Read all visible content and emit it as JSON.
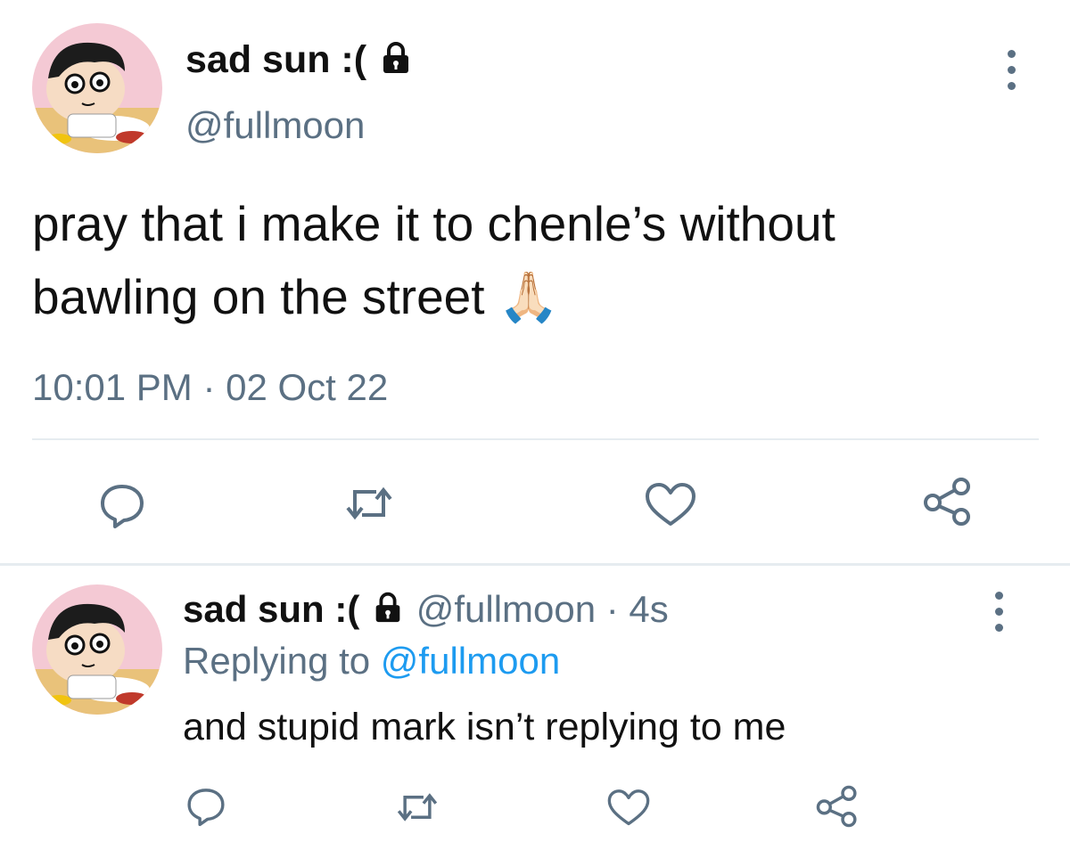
{
  "main_tweet": {
    "display_name": "sad sun :(",
    "handle": "@fullmoon",
    "text_line1": "pray that i make it to chenle’s without",
    "text_line2": "bawling on the street",
    "emoji": "🙏🏻",
    "timestamp": "10:01 PM · 02 Oct 22"
  },
  "reply_tweet": {
    "display_name": "sad sun :(",
    "handle": "@fullmoon",
    "age": "· 4s",
    "replying_label": "Replying to",
    "replying_handle": "@fullmoon",
    "text": "and stupid mark isn’t replying to me"
  },
  "icons": {
    "lock": "lock-icon",
    "more": "more-icon",
    "reply": "reply-icon",
    "retweet": "retweet-icon",
    "like": "heart-icon",
    "share": "share-icon"
  },
  "colors": {
    "text": "#111111",
    "secondary": "#5b7083",
    "accent": "#1d9bf0",
    "divider": "#e6ecf0"
  }
}
